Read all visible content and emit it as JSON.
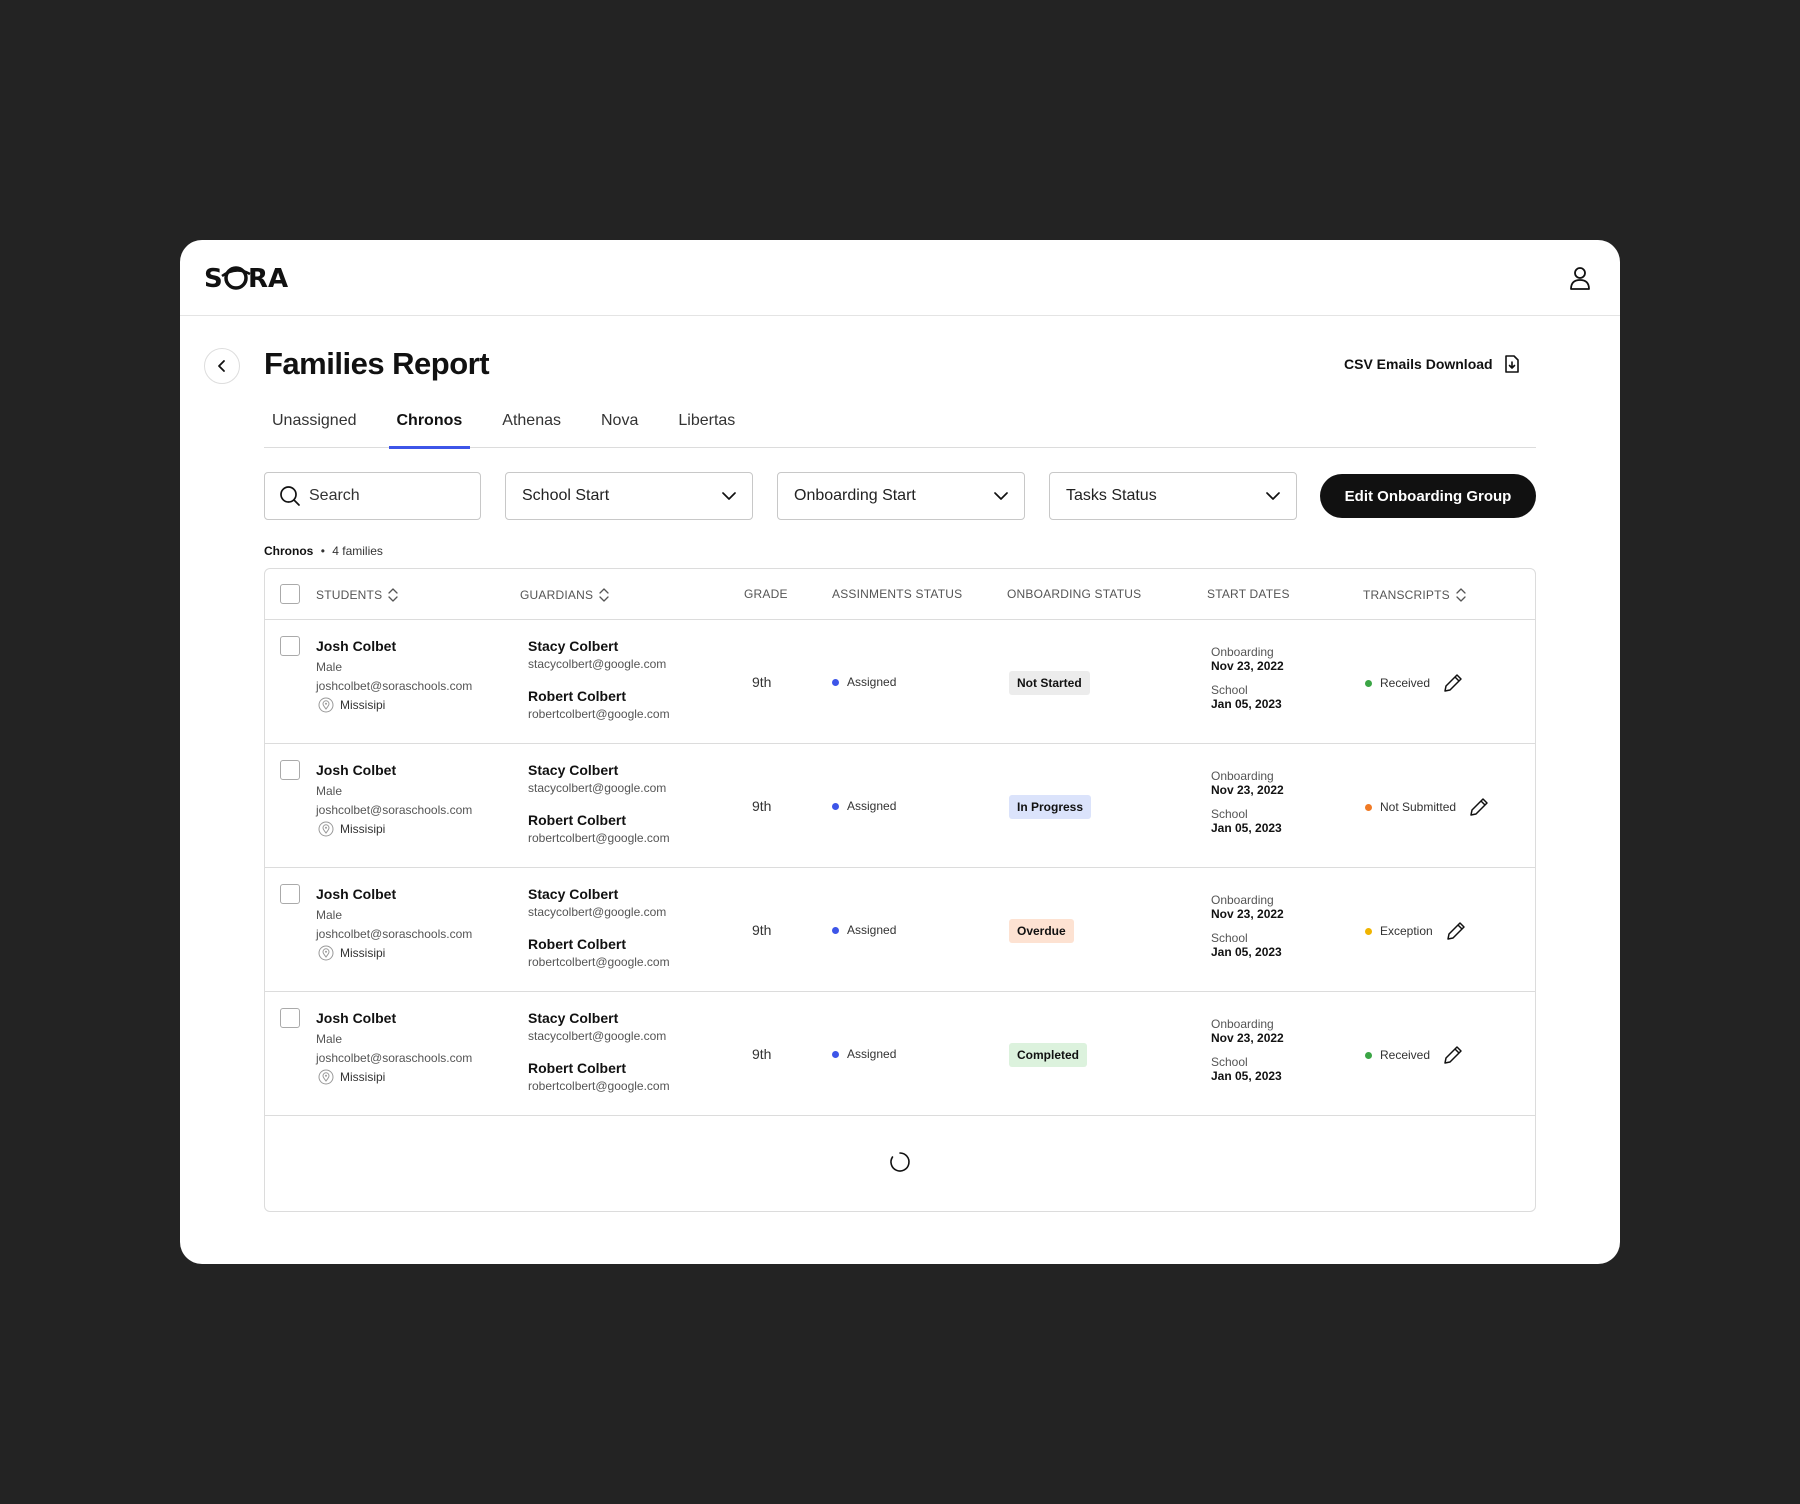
{
  "app": {
    "logo_text": "SORA"
  },
  "page": {
    "title": "Families Report",
    "csv_label": "CSV Emails Download"
  },
  "tabs": [
    {
      "label": "Unassigned",
      "active": false
    },
    {
      "label": "Chronos",
      "active": true
    },
    {
      "label": "Athenas",
      "active": false
    },
    {
      "label": "Nova",
      "active": false
    },
    {
      "label": "Libertas",
      "active": false
    }
  ],
  "filters": {
    "search_placeholder": "Search",
    "school_start": "School Start",
    "onboarding_start": "Onboarding Start",
    "tasks_status": "Tasks Status",
    "edit_group_label": "Edit Onboarding Group"
  },
  "caption": {
    "group": "Chronos",
    "separator": "•",
    "count": "4 families"
  },
  "table": {
    "headers": {
      "students": "STUDENTS",
      "guardians": "GUARDIANS",
      "grade": "GRADE",
      "assignments": "ASSINMENTS STATUS",
      "onboarding": "ONBOARDING STATUS",
      "start_dates": "START DATES",
      "transcripts": "TRANSCRIPTS"
    },
    "rows": [
      {
        "student_name": "Josh Colbet",
        "gender": "Male",
        "email": "joshcolbet@soraschools.com",
        "location": "Missisipi",
        "guardian1_name": "Stacy Colbert",
        "guardian1_email": "stacycolbert@google.com",
        "guardian2_name": "Robert Colbert",
        "guardian2_email": "robertcolbert@google.com",
        "grade": "9th",
        "assignment_status": "Assigned",
        "onboarding_status": "Not Started",
        "onboarding_label": "Onboarding",
        "onboarding_date": "Nov 23, 2022",
        "school_label": "School",
        "school_date": "Jan 05, 2023",
        "transcript_status": "Received"
      },
      {
        "student_name": "Josh Colbet",
        "gender": "Male",
        "email": "joshcolbet@soraschools.com",
        "location": "Missisipi",
        "guardian1_name": "Stacy Colbert",
        "guardian1_email": "stacycolbert@google.com",
        "guardian2_name": "Robert Colbert",
        "guardian2_email": "robertcolbert@google.com",
        "grade": "9th",
        "assignment_status": "Assigned",
        "onboarding_status": "In Progress",
        "onboarding_label": "Onboarding",
        "onboarding_date": "Nov 23, 2022",
        "school_label": "School",
        "school_date": "Jan 05, 2023",
        "transcript_status": "Not Submitted"
      },
      {
        "student_name": "Josh Colbet",
        "gender": "Male",
        "email": "joshcolbet@soraschools.com",
        "location": "Missisipi",
        "guardian1_name": "Stacy Colbert",
        "guardian1_email": "stacycolbert@google.com",
        "guardian2_name": "Robert Colbert",
        "guardian2_email": "robertcolbert@google.com",
        "grade": "9th",
        "assignment_status": "Assigned",
        "onboarding_status": "Overdue",
        "onboarding_label": "Onboarding",
        "onboarding_date": "Nov 23, 2022",
        "school_label": "School",
        "school_date": "Jan 05, 2023",
        "transcript_status": "Exception"
      },
      {
        "student_name": "Josh Colbet",
        "gender": "Male",
        "email": "joshcolbet@soraschools.com",
        "location": "Missisipi",
        "guardian1_name": "Stacy Colbert",
        "guardian1_email": "stacycolbert@google.com",
        "guardian2_name": "Robert Colbert",
        "guardian2_email": "robertcolbert@google.com",
        "grade": "9th",
        "assignment_status": "Assigned",
        "onboarding_status": "Completed",
        "onboarding_label": "Onboarding",
        "onboarding_date": "Nov 23, 2022",
        "school_label": "School",
        "school_date": "Jan 05, 2023",
        "transcript_status": "Received"
      }
    ]
  },
  "colors": {
    "tab_accent": "#3d55e8",
    "assigned_dot": "#3d55e8",
    "received_dot": "#3aa545",
    "not_submitted_dot": "#f07a25",
    "exception_dot": "#f0b400",
    "badge_not_started": "#ececec",
    "badge_in_progress": "#dbe3fb",
    "badge_overdue": "#fde2d2",
    "badge_completed": "#dcf2dd"
  },
  "icons": {
    "back": "chevron-left-icon",
    "user": "user-icon",
    "csv": "download-file-icon",
    "search": "search-icon",
    "dropdown": "chevron-down-icon",
    "sort": "sort-icon",
    "location": "location-pin-icon",
    "edit": "pencil-icon",
    "loading": "spinner-icon"
  }
}
